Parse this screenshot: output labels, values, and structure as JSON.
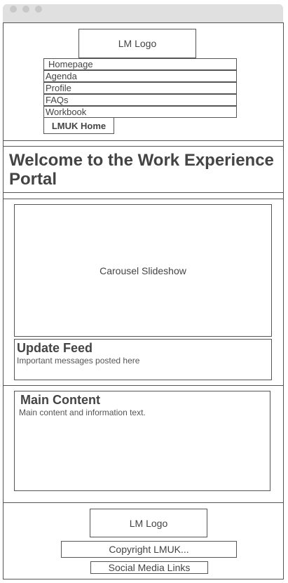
{
  "header": {
    "logo_label": "LM Logo",
    "nav": [
      "Homepage",
      "Agenda",
      "Profile",
      "FAQs",
      "Workbook"
    ],
    "home_button": "LMUK Home"
  },
  "welcome": {
    "title": "Welcome to the Work Experience Portal"
  },
  "carousel": {
    "label": "Carousel Slideshow"
  },
  "update_feed": {
    "heading": "Update Feed",
    "text": "Important messages posted here"
  },
  "main": {
    "heading": "Main Content",
    "text": "Main content and information text."
  },
  "footer": {
    "logo_label": "LM Logo",
    "copyright": "Copyright LMUK...",
    "social": "Social Media Links"
  }
}
